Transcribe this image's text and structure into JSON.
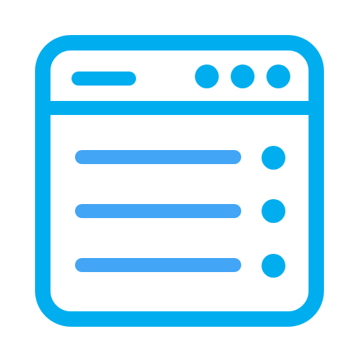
{
  "icon": {
    "name": "browser-window-list-icon",
    "colors": {
      "frame": "#00AEEF",
      "list": "#42A5F5",
      "background": "#FFFFFF"
    },
    "window_controls": [
      "control-dot",
      "control-dot",
      "control-dot"
    ],
    "list_items": [
      {
        "bar": "list-line",
        "marker": "list-bullet"
      },
      {
        "bar": "list-line",
        "marker": "list-bullet"
      },
      {
        "bar": "list-line",
        "marker": "list-bullet"
      }
    ]
  }
}
